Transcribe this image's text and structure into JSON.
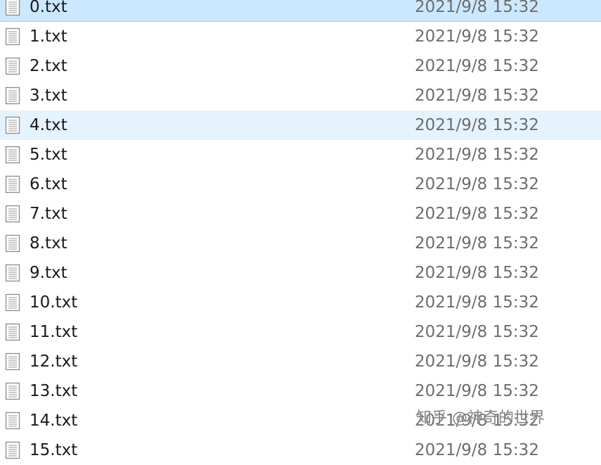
{
  "files": [
    {
      "name": "0.txt",
      "date": "2021/9/8 15:32",
      "state": "selected",
      "icon": "text-file-icon"
    },
    {
      "name": "1.txt",
      "date": "2021/9/8 15:32",
      "state": "normal",
      "icon": "text-file-icon"
    },
    {
      "name": "2.txt",
      "date": "2021/9/8 15:32",
      "state": "normal",
      "icon": "text-file-icon"
    },
    {
      "name": "3.txt",
      "date": "2021/9/8 15:32",
      "state": "normal",
      "icon": "text-file-icon"
    },
    {
      "name": "4.txt",
      "date": "2021/9/8 15:32",
      "state": "hovered",
      "icon": "text-file-icon"
    },
    {
      "name": "5.txt",
      "date": "2021/9/8 15:32",
      "state": "normal",
      "icon": "text-file-icon"
    },
    {
      "name": "6.txt",
      "date": "2021/9/8 15:32",
      "state": "normal",
      "icon": "text-file-icon"
    },
    {
      "name": "7.txt",
      "date": "2021/9/8 15:32",
      "state": "normal",
      "icon": "text-file-icon"
    },
    {
      "name": "8.txt",
      "date": "2021/9/8 15:32",
      "state": "normal",
      "icon": "text-file-icon"
    },
    {
      "name": "9.txt",
      "date": "2021/9/8 15:32",
      "state": "normal",
      "icon": "text-file-icon"
    },
    {
      "name": "10.txt",
      "date": "2021/9/8 15:32",
      "state": "normal",
      "icon": "text-file-icon"
    },
    {
      "name": "11.txt",
      "date": "2021/9/8 15:32",
      "state": "normal",
      "icon": "text-file-icon"
    },
    {
      "name": "12.txt",
      "date": "2021/9/8 15:32",
      "state": "normal",
      "icon": "text-file-icon"
    },
    {
      "name": "13.txt",
      "date": "2021/9/8 15:32",
      "state": "normal",
      "icon": "text-file-icon"
    },
    {
      "name": "14.txt",
      "date": "2021/9/8 15:32",
      "state": "normal",
      "icon": "text-file-icon"
    },
    {
      "name": "15.txt",
      "date": "2021/9/8 15:32",
      "state": "normal",
      "icon": "text-file-icon"
    }
  ],
  "watermark": "知乎 @神奇的世界",
  "colors": {
    "selected_bg": "#cce8ff",
    "hover_bg": "#e5f3ff",
    "name_text": "#1a1a1a",
    "date_text": "#6d6d6d"
  }
}
